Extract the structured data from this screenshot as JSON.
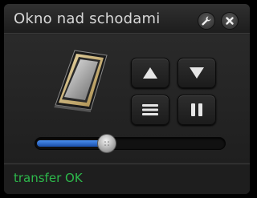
{
  "window": {
    "title": "Okno nad schodami"
  },
  "title_buttons": {
    "settings_icon": "wrench-icon",
    "close_icon": "close-icon"
  },
  "controls": {
    "up_icon": "triangle-up-icon",
    "down_icon": "triangle-down-icon",
    "menu_icon": "three-lines-icon",
    "pause_icon": "pause-icon"
  },
  "slider": {
    "level": 0.37
  },
  "status": {
    "text": "transfer OK",
    "color": "#2db84b"
  },
  "colors": {
    "accent": "#3a7ee0",
    "background": "#262626"
  }
}
